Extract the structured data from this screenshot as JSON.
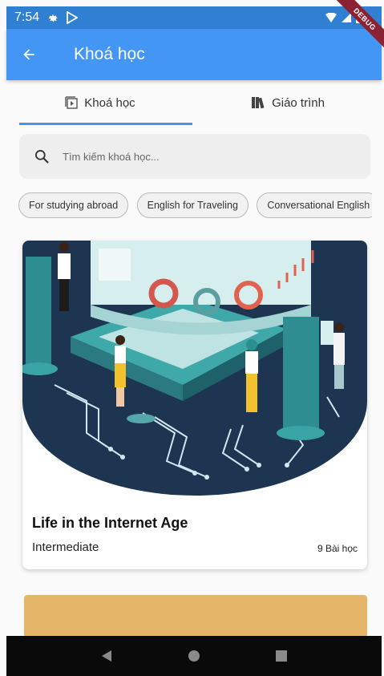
{
  "status_bar": {
    "time": "7:54",
    "debug_label": "DEBUG"
  },
  "app_bar": {
    "title": "Khoá học"
  },
  "tabs": [
    {
      "label": "Khoá học",
      "icon": "play-box-icon",
      "active": true
    },
    {
      "label": "Giáo trình",
      "icon": "books-icon",
      "active": false
    }
  ],
  "search": {
    "placeholder": "Tìm kiếm khoá học..."
  },
  "chips": [
    "For studying abroad",
    "English for Traveling",
    "Conversational English"
  ],
  "courses": [
    {
      "title": "Life in the Internet Age",
      "level": "Intermediate",
      "lessons": "9 Bài học"
    }
  ],
  "colors": {
    "status_bar": "#2f7fd3",
    "app_bar": "#4396f3",
    "accent": "#4396f3",
    "debug_ribbon": "#8b2234",
    "card2_bg": "#e5b66a"
  }
}
